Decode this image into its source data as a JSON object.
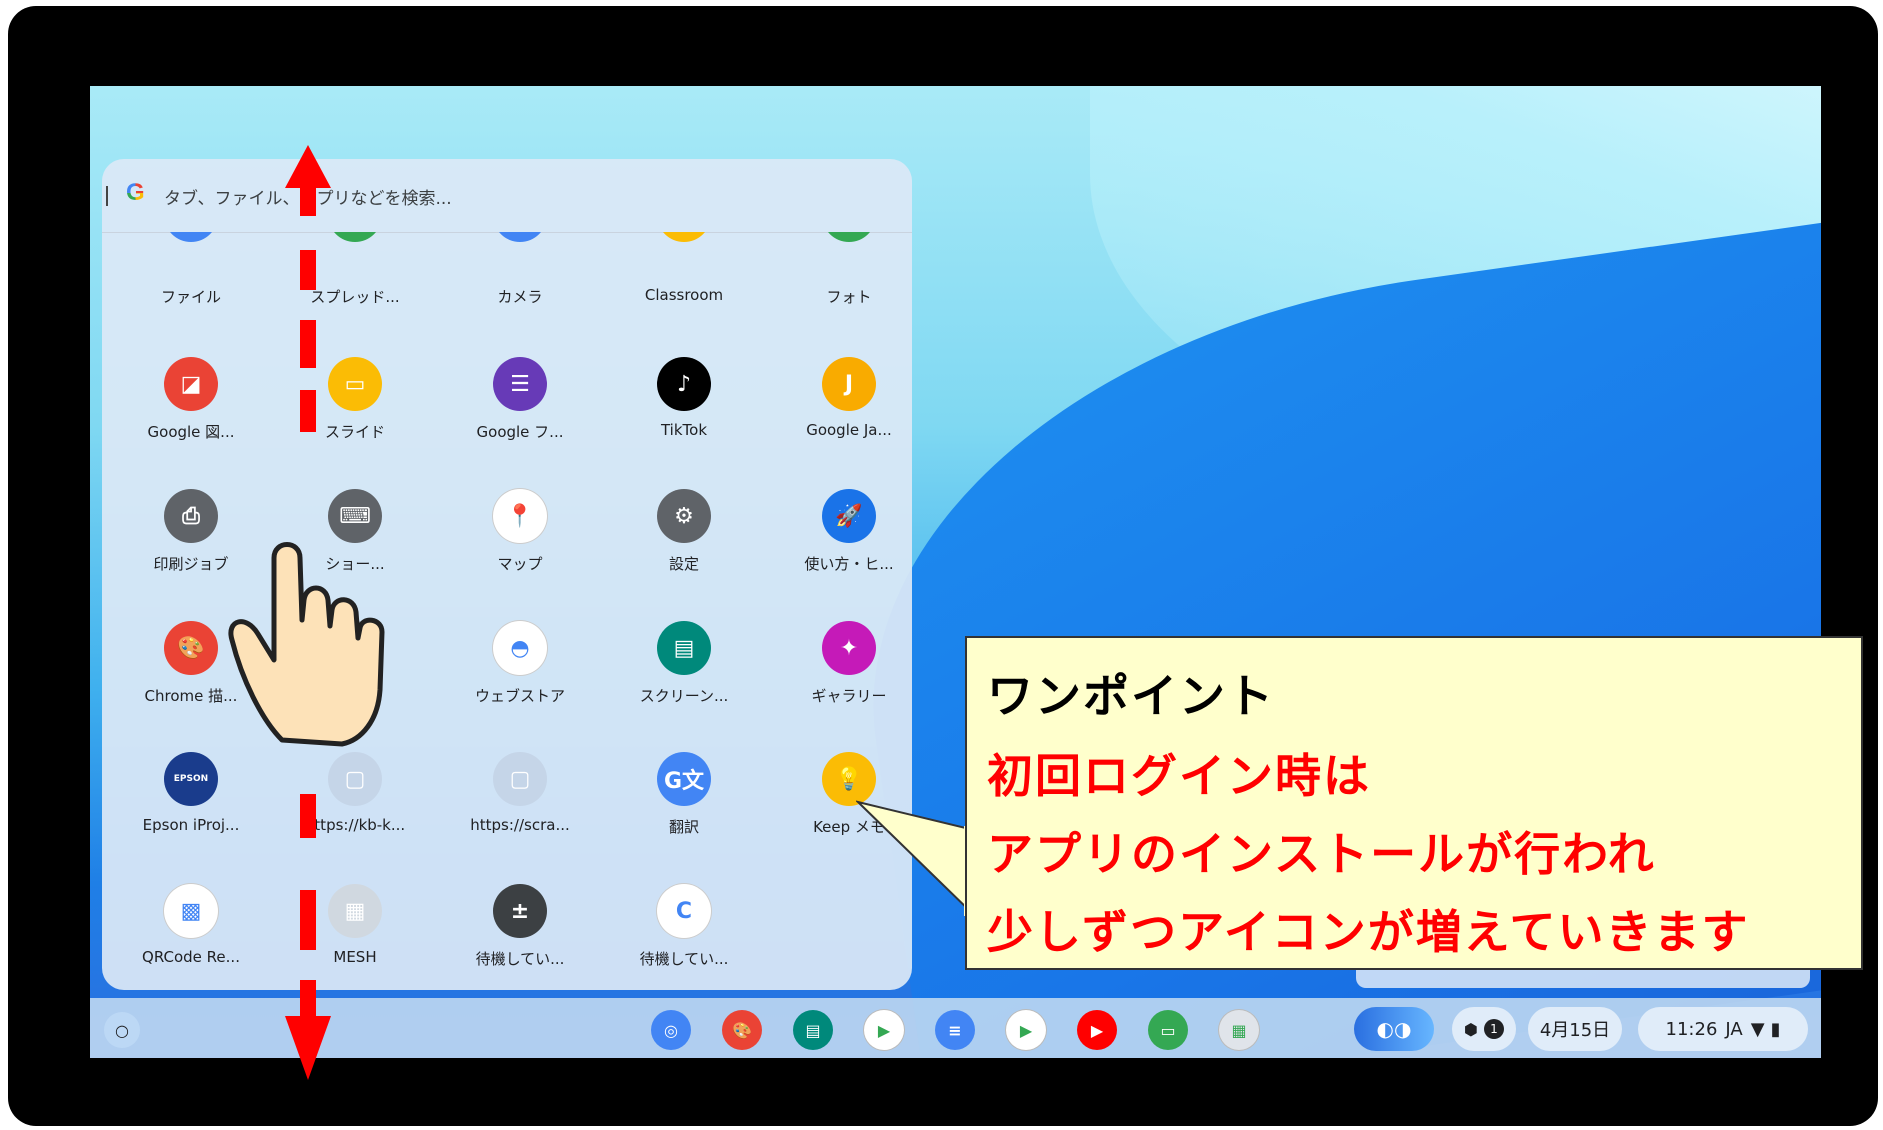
{
  "launcher": {
    "search_placeholder": "タブ、ファイル、アプリなどを検索...",
    "google_logo": "G",
    "apps": [
      {
        "label": "ファイル",
        "icon": "files-icon",
        "color": "#4285f4",
        "glyph": "▬"
      },
      {
        "label": "スプレッド...",
        "icon": "sheets-icon",
        "color": "#34a853",
        "glyph": "▦"
      },
      {
        "label": "カメラ",
        "icon": "camera-icon",
        "color": "#4285f4",
        "glyph": "◉"
      },
      {
        "label": "Classroom",
        "icon": "classroom-icon",
        "color": "#fbbc05",
        "glyph": "▭"
      },
      {
        "label": "フォト",
        "icon": "photos-icon",
        "color": "#34a853",
        "glyph": "✿"
      },
      {
        "label": "Google 図...",
        "icon": "drawings-icon",
        "color": "#ea4335",
        "glyph": "◪"
      },
      {
        "label": "スライド",
        "icon": "slides-icon",
        "color": "#fbbc05",
        "glyph": "▭"
      },
      {
        "label": "Google フ...",
        "icon": "forms-icon",
        "color": "#673ab7",
        "glyph": "☰"
      },
      {
        "label": "TikTok",
        "icon": "tiktok-icon",
        "color": "#000000",
        "glyph": "♪"
      },
      {
        "label": "Google Ja...",
        "icon": "jamboard-icon",
        "color": "#f9ab00",
        "glyph": "J"
      },
      {
        "label": "印刷ジョブ",
        "icon": "print-jobs-icon",
        "color": "#5f6368",
        "glyph": "⎙"
      },
      {
        "label": "ショー...",
        "icon": "shortcuts-icon",
        "color": "#5f6368",
        "glyph": "⌨"
      },
      {
        "label": "マップ",
        "icon": "maps-icon",
        "color": "#ffffff",
        "glyph": "📍"
      },
      {
        "label": "設定",
        "icon": "settings-icon",
        "color": "#5f6368",
        "glyph": "⚙"
      },
      {
        "label": "使い方・ヒ...",
        "icon": "explore-icon",
        "color": "#1a73e8",
        "glyph": "🚀"
      },
      {
        "label": "Chrome 描...",
        "icon": "chrome-canvas-icon",
        "color": "#ea4335",
        "glyph": "🎨"
      },
      {
        "label": "",
        "icon": "hidden-app-icon",
        "color": "#9aa0a6",
        "glyph": ""
      },
      {
        "label": "ウェブストア",
        "icon": "webstore-icon",
        "color": "#ffffff",
        "glyph": "◓"
      },
      {
        "label": "スクリーン...",
        "icon": "screencast-icon",
        "color": "#00897b",
        "glyph": "▤"
      },
      {
        "label": "ギャラリー",
        "icon": "gallery-icon",
        "color": "#c51ab8",
        "glyph": "✦"
      },
      {
        "label": "Epson iProj...",
        "icon": "epson-iprojection-icon",
        "color": "#1a3c8c",
        "glyph": "EPSON"
      },
      {
        "label": "https://kb-k...",
        "icon": "web-app-icon",
        "color": "#c5d5e8",
        "glyph": "▢"
      },
      {
        "label": "https://scra...",
        "icon": "scratch-web-app-icon",
        "color": "#c5d5e8",
        "glyph": "▢"
      },
      {
        "label": "翻訳",
        "icon": "translate-icon",
        "color": "#4285f4",
        "glyph": "G文"
      },
      {
        "label": "Keep メモ",
        "icon": "keep-icon",
        "color": "#fbbc05",
        "glyph": "💡"
      },
      {
        "label": "QRCode Re...",
        "icon": "qrcode-reader-icon",
        "color": "#ffffff",
        "glyph": "▩"
      },
      {
        "label": "MESH",
        "icon": "mesh-icon",
        "color": "#d0d8e0",
        "glyph": "▦"
      },
      {
        "label": "待機してい...",
        "icon": "calculator-icon",
        "color": "#3c4043",
        "glyph": "±"
      },
      {
        "label": "待機してい...",
        "icon": "pending-app-icon",
        "color": "#ffffff",
        "glyph": "C"
      }
    ]
  },
  "shelf": {
    "home_glyph": "○",
    "apps": [
      {
        "icon": "chrome-icon",
        "color": "#4285f4",
        "glyph": "◎"
      },
      {
        "icon": "chrome-canvas-icon",
        "color": "#ea4335",
        "glyph": "🎨"
      },
      {
        "icon": "screencast-icon",
        "color": "#00897b",
        "glyph": "▤"
      },
      {
        "icon": "play-store-icon",
        "color": "#ffffff",
        "glyph": "▶"
      },
      {
        "icon": "docs-icon",
        "color": "#4285f4",
        "glyph": "≡"
      },
      {
        "icon": "meet-icon",
        "color": "#ffffff",
        "glyph": "▶"
      },
      {
        "icon": "youtube-icon",
        "color": "#ff0000",
        "glyph": "▶"
      },
      {
        "icon": "classroom-icon",
        "color": "#34a853",
        "glyph": "▭"
      },
      {
        "icon": "mesh-icon",
        "color": "#e0e4ea",
        "glyph": "▦"
      }
    ],
    "date": "4月15日",
    "time": "11:26",
    "ime": "JA",
    "notification_count": "1"
  },
  "callout": {
    "title": "ワンポイント",
    "line1": "初回ログイン時は",
    "line2": "アプリのインストールが行われ",
    "line3": "少しずつアイコンが増えていきます",
    "title_color": "#000000",
    "text_color": "#ff0000"
  },
  "colors": {
    "arrow": "#ff0000",
    "bezel": "#000000",
    "callout_bg": "#ffffcc"
  }
}
